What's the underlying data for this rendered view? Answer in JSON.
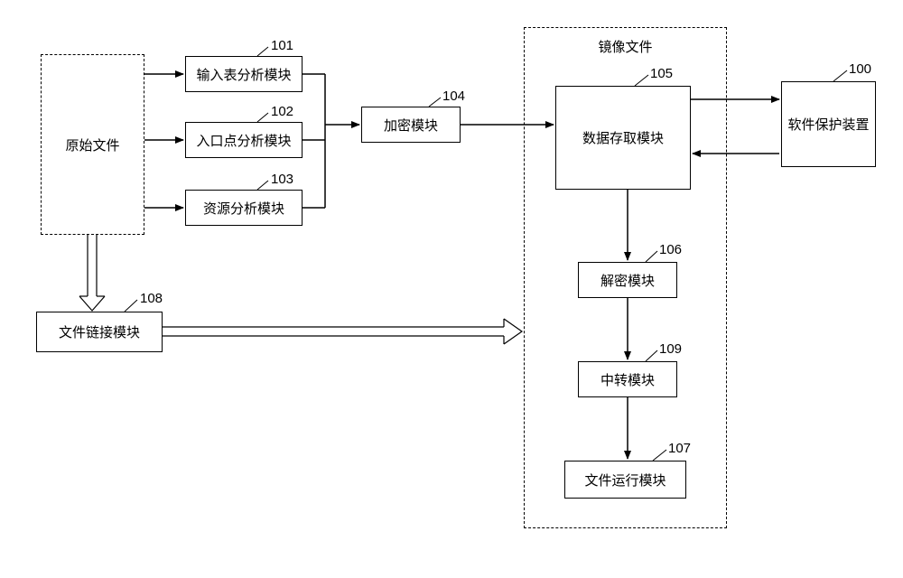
{
  "diagram": {
    "original_file": "原始文件",
    "file_link_module": "文件链接模块",
    "input_table_module": "输入表分析模块",
    "entry_point_module": "入口点分析模块",
    "resource_module": "资源分析模块",
    "encrypt_module": "加密模块",
    "mirror_file_title": "镜像文件",
    "data_access_module": "数据存取模块",
    "decrypt_module": "解密模块",
    "relay_module": "中转模块",
    "file_run_module": "文件运行模块",
    "software_protect": "软件保护装置"
  },
  "ids": {
    "n100": "100",
    "n101": "101",
    "n102": "102",
    "n103": "103",
    "n104": "104",
    "n105": "105",
    "n106": "106",
    "n107": "107",
    "n108": "108",
    "n109": "109"
  }
}
